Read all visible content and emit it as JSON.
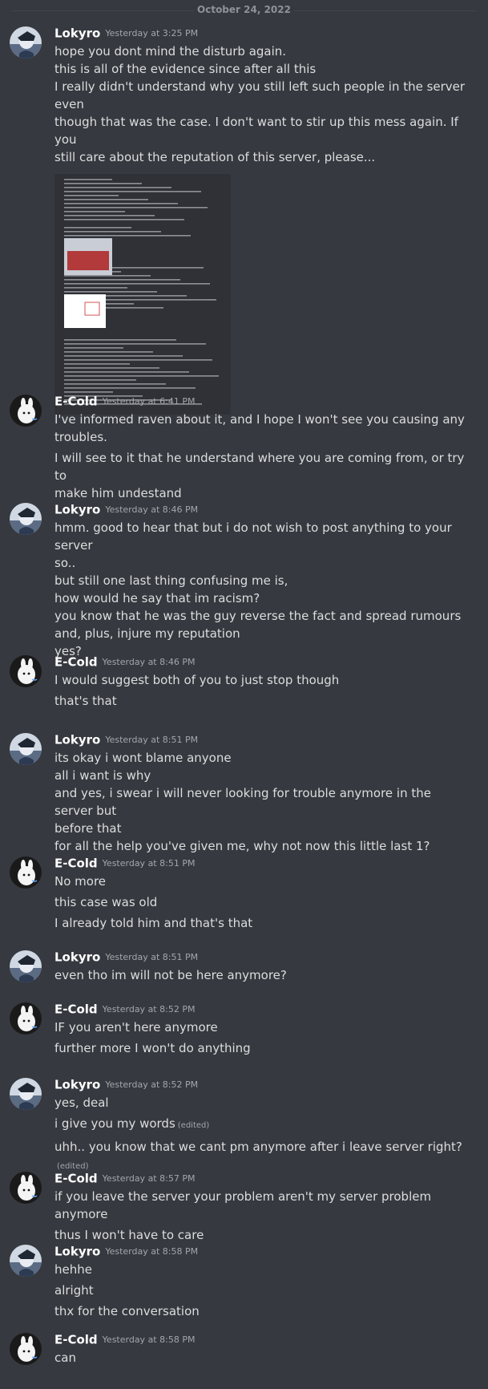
{
  "channel": {
    "date_divider": "October 24, 2022"
  },
  "messages": [
    {
      "author": "Lokyro",
      "avatar": "lokyro-avatar",
      "timestamp": "Yesterday at 3:25 PM",
      "lines": [
        {
          "text": "hope you dont mind the disturb again."
        },
        {
          "text": "this is all of the evidence since after all this"
        },
        {
          "text": "I really didn't understand why you still left such people in the server even"
        },
        {
          "text": "though that was the case. I don't want to stir up this mess again. If you"
        },
        {
          "text": "still care about the reputation of this server, please..."
        }
      ],
      "attachment": "screenshot-evidence-image"
    },
    {
      "author": "E-Cold",
      "avatar": "ecold-avatar",
      "timestamp": "Yesterday at 6:41 PM",
      "lines": [
        {
          "text": "I've informed raven about it, and I hope I won't see you causing any"
        },
        {
          "text": "troubles."
        },
        {
          "text": "I will see to it that he understand where you are coming from, or try to"
        },
        {
          "text": "make him undestand"
        }
      ]
    },
    {
      "author": "Lokyro",
      "avatar": "lokyro-avatar",
      "timestamp": "Yesterday at 8:46 PM",
      "lines": [
        {
          "text": "hmm. good to hear that but i do not wish to post anything to your server"
        },
        {
          "text": "so.."
        },
        {
          "text": "but still one last thing confusing me is,"
        },
        {
          "text": "how would he say that im racism?"
        },
        {
          "text": "you know that he was the guy reverse the fact and spread rumours"
        },
        {
          "text": "and,  plus, injure my reputation"
        },
        {
          "text": "yes?"
        }
      ]
    },
    {
      "author": "E-Cold",
      "avatar": "ecold-avatar",
      "timestamp": "Yesterday at 8:46 PM",
      "lines": [
        {
          "text": "I would suggest both of you to just stop though"
        },
        {
          "text": "that's that"
        }
      ]
    },
    {
      "author": "Lokyro",
      "avatar": "lokyro-avatar",
      "timestamp": "Yesterday at 8:51 PM",
      "lines": [
        {
          "text": "its okay i wont blame anyone"
        },
        {
          "text": "all i want is why"
        },
        {
          "text": "and yes, i swear i will never looking for trouble anymore in the server but"
        },
        {
          "text": "before that"
        },
        {
          "text": "for all the help you've given me, why not now this little last 1?"
        }
      ]
    },
    {
      "author": "E-Cold",
      "avatar": "ecold-avatar",
      "timestamp": "Yesterday at 8:51 PM",
      "lines": [
        {
          "text": "No more"
        },
        {
          "text": "this case was old"
        },
        {
          "text": "I already told him and that's that"
        }
      ]
    },
    {
      "author": "Lokyro",
      "avatar": "lokyro-avatar",
      "timestamp": "Yesterday at 8:51 PM",
      "lines": [
        {
          "text": "even tho im will not be here anymore?"
        }
      ]
    },
    {
      "author": "E-Cold",
      "avatar": "ecold-avatar",
      "timestamp": "Yesterday at 8:52 PM",
      "lines": [
        {
          "text": "IF you aren't here anymore"
        },
        {
          "text": "further more I won't do anything"
        }
      ]
    },
    {
      "author": "Lokyro",
      "avatar": "lokyro-avatar",
      "timestamp": "Yesterday at 8:52 PM",
      "lines": [
        {
          "text": "yes, deal"
        },
        {
          "text": "i give you my words",
          "edited": "(edited)"
        },
        {
          "text": "uhh.. you know that we cant pm anymore after i leave server right?",
          "edited": "(edited)"
        }
      ]
    },
    {
      "author": "E-Cold",
      "avatar": "ecold-avatar",
      "timestamp": "Yesterday at 8:57 PM",
      "lines": [
        {
          "text": "if you leave the server your problem aren't my server problem anymore"
        },
        {
          "text": "thus I won't have to care"
        }
      ]
    },
    {
      "author": "Lokyro",
      "avatar": "lokyro-avatar",
      "timestamp": "Yesterday at 8:58 PM",
      "lines": [
        {
          "text": "hehhe"
        },
        {
          "text": "alright"
        },
        {
          "text": "thx for the conversation"
        }
      ]
    },
    {
      "author": "E-Cold",
      "avatar": "ecold-avatar",
      "timestamp": "Yesterday at 8:58 PM",
      "lines": [
        {
          "text": "can"
        }
      ]
    }
  ]
}
